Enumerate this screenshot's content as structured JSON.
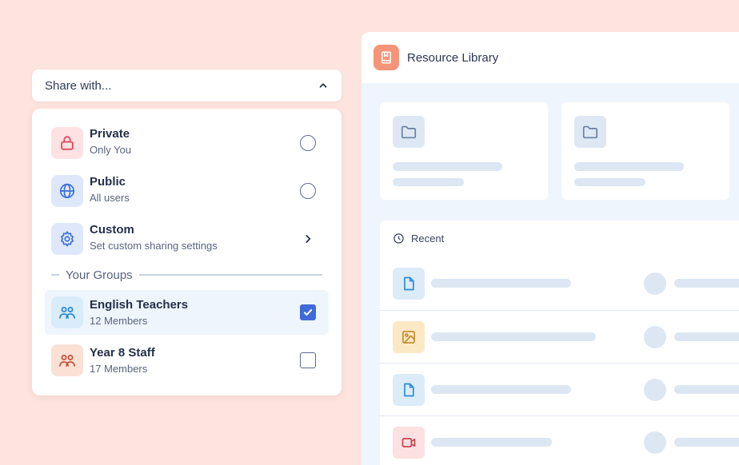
{
  "library": {
    "title": "Resource Library",
    "logo_icon": "book-bookmark-icon",
    "recent_label": "Recent",
    "recent_files": [
      {
        "icon": "document-icon",
        "color": "#2b8bd6",
        "bg": "#dcebf8"
      },
      {
        "icon": "image-icon",
        "color": "#c48a2a",
        "bg": "#fbe9c6"
      },
      {
        "icon": "document-icon",
        "color": "#2b8bd6",
        "bg": "#dcebf8"
      },
      {
        "icon": "video-icon",
        "color": "#c9414a",
        "bg": "#fbe1e1"
      }
    ]
  },
  "share": {
    "select_label": "Share with...",
    "options": [
      {
        "title": "Private",
        "subtitle": "Only You",
        "icon": "lock-icon",
        "control": "radio",
        "checked": false
      },
      {
        "title": "Public",
        "subtitle": "All users",
        "icon": "globe-icon",
        "control": "radio",
        "checked": false
      },
      {
        "title": "Custom",
        "subtitle": "Set custom sharing settings",
        "icon": "gear-icon",
        "control": "chevron"
      }
    ],
    "groups_heading": "Your Groups",
    "groups": [
      {
        "title": "English Teachers",
        "subtitle": "12 Members",
        "icon": "users-icon",
        "checked": true
      },
      {
        "title": "Year 8 Staff",
        "subtitle": "17 Members",
        "icon": "users-icon",
        "checked": false
      }
    ]
  },
  "colors": {
    "background": "#fde4de",
    "accent": "#3f6ad8",
    "private_red": "#e0495a",
    "public_blue": "#3b6fd6",
    "group_blue": "#2b8bd6",
    "group_orange": "#c8553a"
  }
}
